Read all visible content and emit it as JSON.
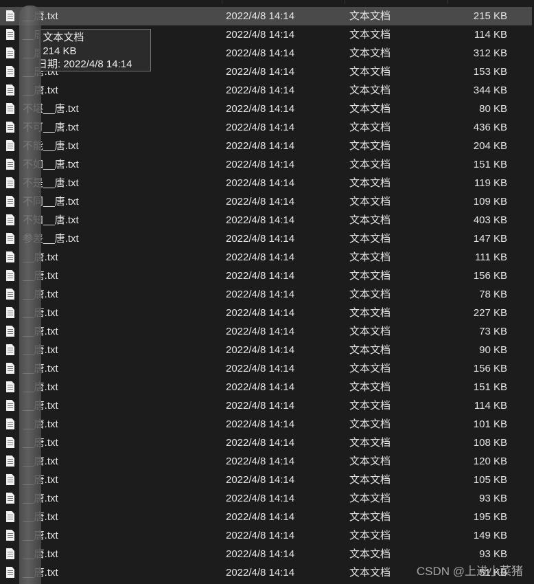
{
  "colors": {
    "background": "#1c1c1c",
    "selected_row": "#4a4a4a",
    "text": "#e4e4e4"
  },
  "file_icon": "text-file-icon",
  "files": [
    {
      "name": "__唐.txt",
      "date": "2022/4/8 14:14",
      "type": "文本文档",
      "size": "215 KB"
    },
    {
      "name": "__唐.txt",
      "date": "2022/4/8 14:14",
      "type": "文本文档",
      "size": "114 KB"
    },
    {
      "name": "__唐.txt",
      "date": "2022/4/8 14:14",
      "type": "文本文档",
      "size": "312 KB"
    },
    {
      "name": "__唐.txt",
      "date": "2022/4/8 14:14",
      "type": "文本文档",
      "size": "153 KB"
    },
    {
      "name": "__唐.txt",
      "date": "2022/4/8 14:14",
      "type": "文本文档",
      "size": "344 KB"
    },
    {
      "name": "不堪__唐.txt",
      "date": "2022/4/8 14:14",
      "type": "文本文档",
      "size": "80 KB"
    },
    {
      "name": "不可__唐.txt",
      "date": "2022/4/8 14:14",
      "type": "文本文档",
      "size": "436 KB"
    },
    {
      "name": "不能__唐.txt",
      "date": "2022/4/8 14:14",
      "type": "文本文档",
      "size": "204 KB"
    },
    {
      "name": "不如__唐.txt",
      "date": "2022/4/8 14:14",
      "type": "文本文档",
      "size": "151 KB"
    },
    {
      "name": "不是__唐.txt",
      "date": "2022/4/8 14:14",
      "type": "文本文档",
      "size": "119 KB"
    },
    {
      "name": "不同__唐.txt",
      "date": "2022/4/8 14:14",
      "type": "文本文档",
      "size": "109 KB"
    },
    {
      "name": "不知__唐.txt",
      "date": "2022/4/8 14:14",
      "type": "文本文档",
      "size": "403 KB"
    },
    {
      "name": "参差__唐.txt",
      "date": "2022/4/8 14:14",
      "type": "文本文档",
      "size": "147 KB"
    },
    {
      "name": "__唐.txt",
      "date": "2022/4/8 14:14",
      "type": "文本文档",
      "size": "111 KB"
    },
    {
      "name": "__唐.txt",
      "date": "2022/4/8 14:14",
      "type": "文本文档",
      "size": "156 KB"
    },
    {
      "name": "__唐.txt",
      "date": "2022/4/8 14:14",
      "type": "文本文档",
      "size": "78 KB"
    },
    {
      "name": "__唐.txt",
      "date": "2022/4/8 14:14",
      "type": "文本文档",
      "size": "227 KB"
    },
    {
      "name": "__唐.txt",
      "date": "2022/4/8 14:14",
      "type": "文本文档",
      "size": "73 KB"
    },
    {
      "name": "__唐.txt",
      "date": "2022/4/8 14:14",
      "type": "文本文档",
      "size": "90 KB"
    },
    {
      "name": "__唐.txt",
      "date": "2022/4/8 14:14",
      "type": "文本文档",
      "size": "156 KB"
    },
    {
      "name": "__唐.txt",
      "date": "2022/4/8 14:14",
      "type": "文本文档",
      "size": "151 KB"
    },
    {
      "name": "__唐.txt",
      "date": "2022/4/8 14:14",
      "type": "文本文档",
      "size": "114 KB"
    },
    {
      "name": "__唐.txt",
      "date": "2022/4/8 14:14",
      "type": "文本文档",
      "size": "101 KB"
    },
    {
      "name": "__唐.txt",
      "date": "2022/4/8 14:14",
      "type": "文本文档",
      "size": "108 KB"
    },
    {
      "name": "__唐.txt",
      "date": "2022/4/8 14:14",
      "type": "文本文档",
      "size": "120 KB"
    },
    {
      "name": "__唐.txt",
      "date": "2022/4/8 14:14",
      "type": "文本文档",
      "size": "105 KB"
    },
    {
      "name": "__唐.txt",
      "date": "2022/4/8 14:14",
      "type": "文本文档",
      "size": "93 KB"
    },
    {
      "name": "__唐.txt",
      "date": "2022/4/8 14:14",
      "type": "文本文档",
      "size": "195 KB"
    },
    {
      "name": "__唐.txt",
      "date": "2022/4/8 14:14",
      "type": "文本文档",
      "size": "149 KB"
    },
    {
      "name": "__唐.txt",
      "date": "2022/4/8 14:14",
      "type": "文本文档",
      "size": "93 KB"
    },
    {
      "name": "__唐.txt",
      "date": "2022/4/8 14:14",
      "type": "文本文档",
      "size": "51 KB"
    }
  ],
  "tooltip": {
    "type_line": "类型: 文本文档",
    "size_line": "大小: 214 KB",
    "date_line": "修改日期: 2022/4/8 14:14"
  },
  "watermark": "CSDN @上进小菜猪"
}
